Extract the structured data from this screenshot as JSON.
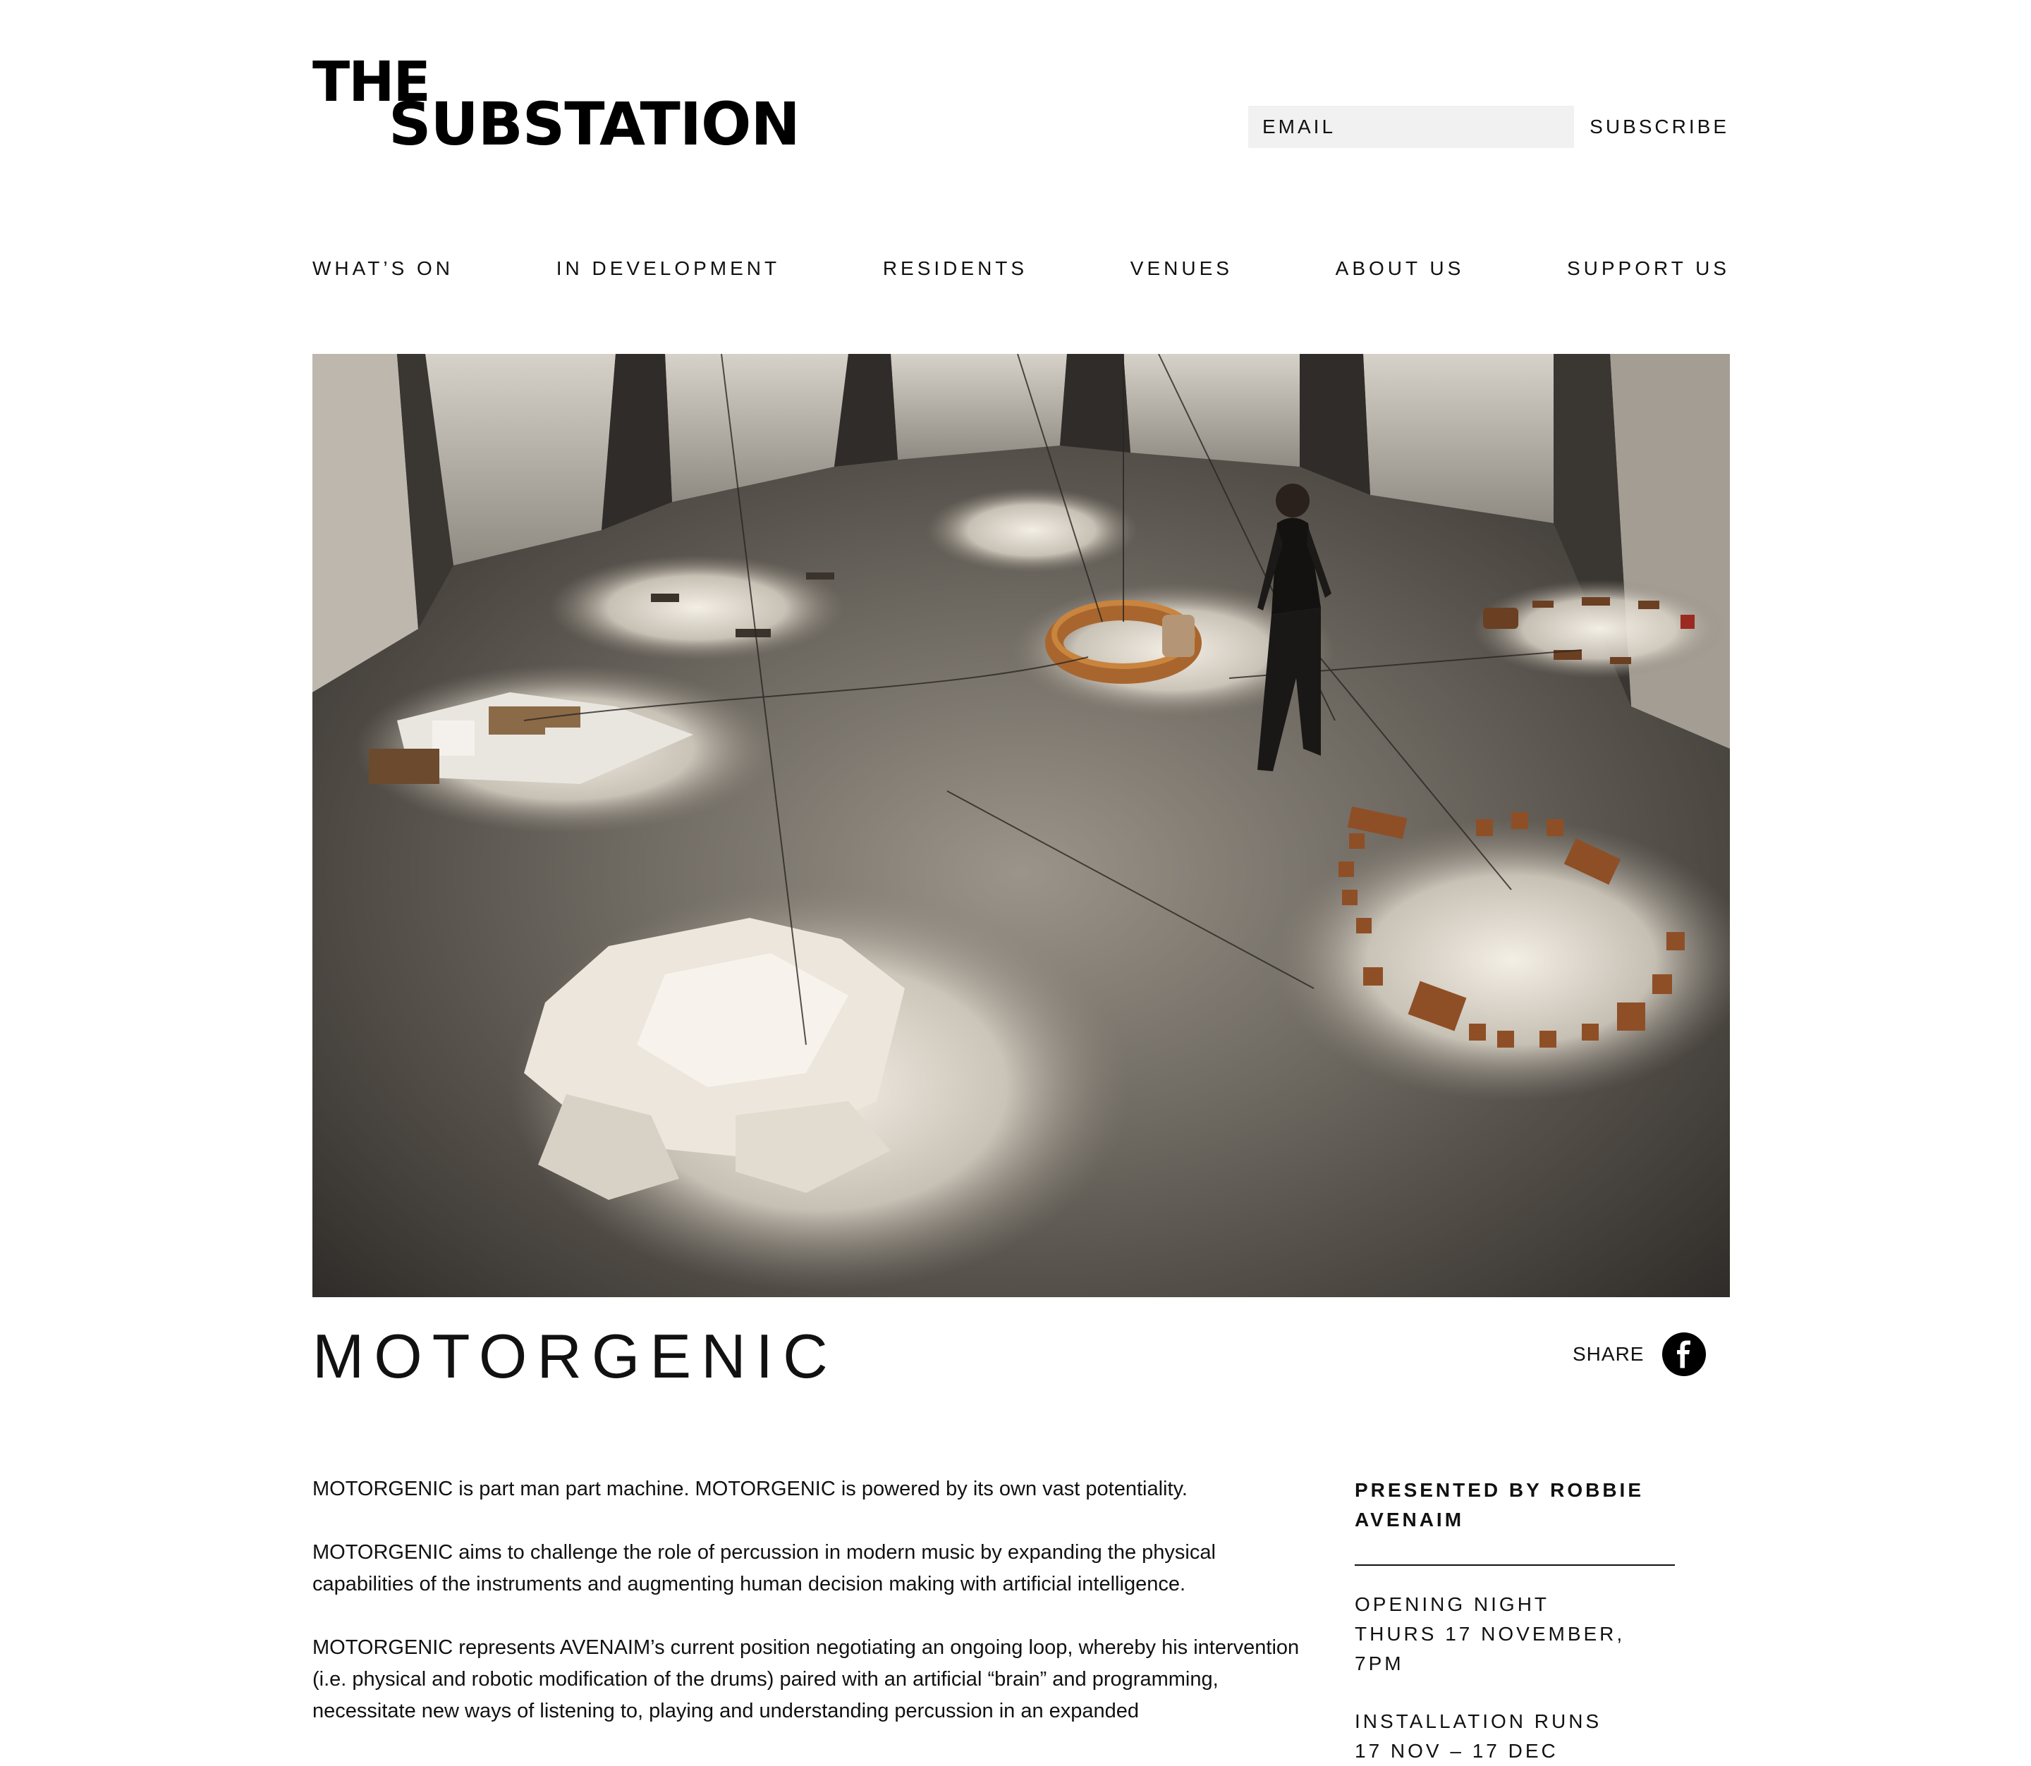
{
  "logo": {
    "line1": "THE",
    "line2": "SUBSTATION"
  },
  "subscribe": {
    "email_placeholder": "EMAIL",
    "button_label": "SUBSCRIBE"
  },
  "nav": {
    "items": [
      {
        "label": "WHAT’S ON"
      },
      {
        "label": "IN DEVELOPMENT"
      },
      {
        "label": "RESIDENTS"
      },
      {
        "label": "VENUES"
      },
      {
        "label": "ABOUT US"
      },
      {
        "label": "SUPPORT US"
      }
    ]
  },
  "event": {
    "title": "MOTORGENIC",
    "share_label": "SHARE",
    "description": [
      "MOTORGENIC is part man part machine. MOTORGENIC is powered by its own vast potentiality.",
      "MOTORGENIC aims to challenge the role of percussion in modern music by expanding the physical capabilities of the instruments and augmenting human decision making with artificial intelligence.",
      "MOTORGENIC represents AVENAIM’s current position negotiating an ongoing loop, whereby his intervention (i.e. physical and robotic modification of the drums) paired with an artificial “brain” and programming, necessitate new ways of listening to, playing and understanding percussion in an expanded"
    ]
  },
  "info": {
    "presented_by": "PRESENTED BY ROBBIE AVENAIM",
    "opening_night_label": "OPENING NIGHT",
    "opening_night_value": "THURS 17 NOVEMBER, 7PM",
    "installation_label": "INSTALLATION RUNS",
    "installation_value": "17 NOV – 17 DEC"
  },
  "icons": {
    "share": "facebook-icon"
  }
}
